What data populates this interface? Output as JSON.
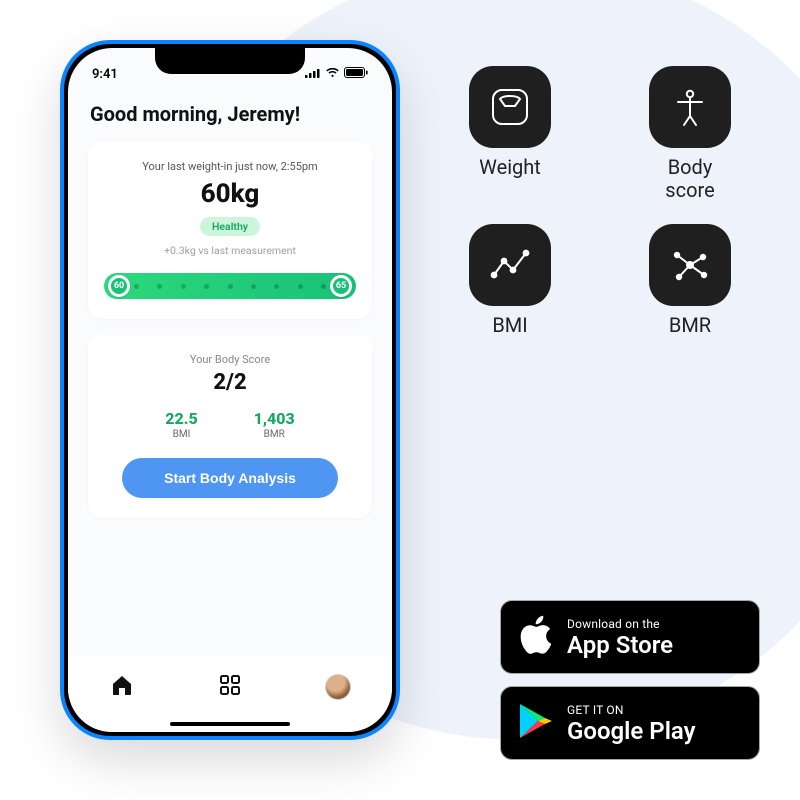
{
  "statusbar": {
    "time": "9:41"
  },
  "greeting": "Good morning, Jeremy!",
  "weight_card": {
    "subtitle": "Your last weight-in just now, 2:55pm",
    "weight": "60kg",
    "badge": "Healthy",
    "delta": "+0.3kg vs last measurement",
    "range_min": "60",
    "range_max": "65"
  },
  "score_card": {
    "subtitle": "Your Body Score",
    "score": "2/2",
    "bmi_value": "22.5",
    "bmi_label": "BMI",
    "bmr_value": "1,403",
    "bmr_label": "BMR",
    "cta": "Start Body Analysis"
  },
  "features": {
    "weight": "Weight",
    "body_score": "Body\nscore",
    "bmi": "BMI",
    "bmr": "BMR"
  },
  "stores": {
    "apple_top": "Download on the",
    "apple_bottom": "App Store",
    "google_top": "GET IT ON",
    "google_bottom": "Google Play"
  }
}
